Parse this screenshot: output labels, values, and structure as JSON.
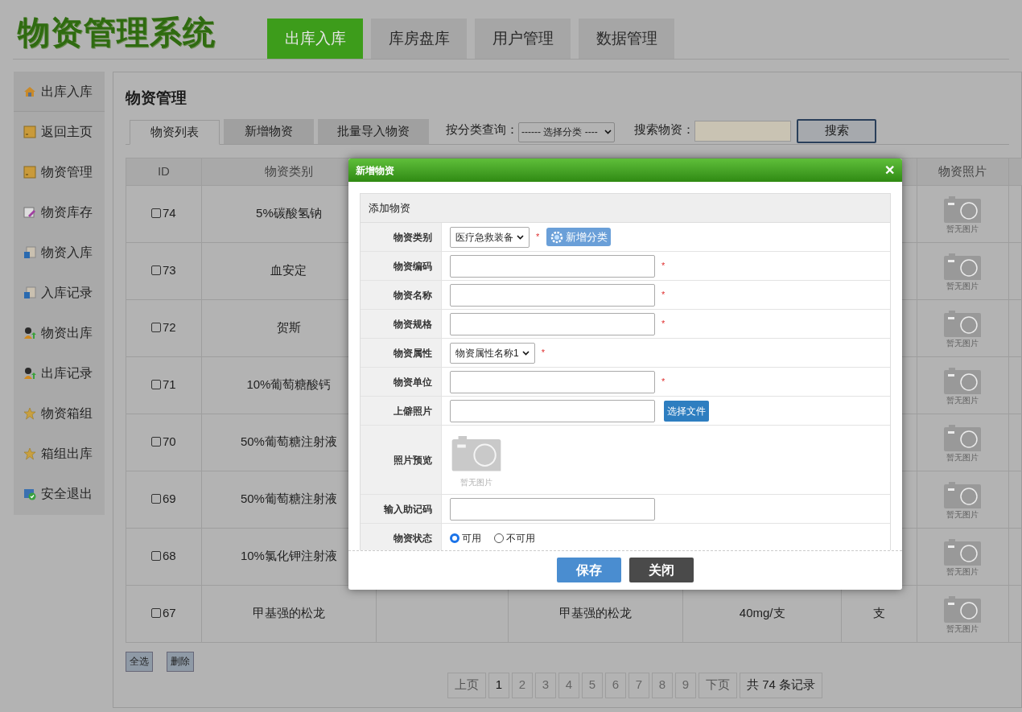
{
  "logo": "物资管理系统",
  "nav": [
    {
      "label": "出库入库",
      "selected": true
    },
    {
      "label": "库房盘库",
      "selected": false
    },
    {
      "label": "用户管理",
      "selected": false
    },
    {
      "label": "数据管理",
      "selected": false
    }
  ],
  "sidebar": {
    "items": [
      {
        "label": "出库入库",
        "selected": true
      },
      {
        "label": "返回主页",
        "selected": false
      },
      {
        "label": "物资管理",
        "selected": false
      },
      {
        "label": "物资库存",
        "selected": false
      },
      {
        "label": "物资入库",
        "selected": false
      },
      {
        "label": "入库记录",
        "selected": false
      },
      {
        "label": "物资出库",
        "selected": false
      },
      {
        "label": "出库记录",
        "selected": false
      },
      {
        "label": "物资箱组",
        "selected": false
      },
      {
        "label": "箱组出库",
        "selected": false
      },
      {
        "label": "安全退出",
        "selected": false
      }
    ]
  },
  "page_title": "物资管理",
  "tabs": [
    {
      "label": "物资列表",
      "selected": true
    },
    {
      "label": "新增物资",
      "selected": false
    },
    {
      "label": "批量导入物资",
      "selected": false
    }
  ],
  "filter": {
    "label": "按分类查询：",
    "value": "------ 选择分类 ----"
  },
  "search": {
    "label": "搜索物资：",
    "button": "搜索"
  },
  "table": {
    "columns": [
      "ID",
      "物资类别",
      "物资照片"
    ],
    "rows": [
      {
        "id": "74",
        "checked": false,
        "category": "5%碳酸氢钠",
        "photo_caption": "暂无图片"
      },
      {
        "id": "73",
        "checked": false,
        "category": "血安定",
        "photo_caption": "暂无图片"
      },
      {
        "id": "72",
        "checked": false,
        "category": "贺斯",
        "photo_caption": "暂无图片"
      },
      {
        "id": "71",
        "checked": false,
        "category": "10%葡萄糖酸钙",
        "photo_caption": "暂无图片"
      },
      {
        "id": "70",
        "checked": false,
        "category": "50%葡萄糖注射液",
        "photo_caption": "暂无图片"
      },
      {
        "id": "69",
        "checked": false,
        "category": "50%葡萄糖注射液",
        "photo_caption": "暂无图片"
      },
      {
        "id": "68",
        "checked": false,
        "category": "10%氯化钾注射液",
        "photo_caption": "暂无图片"
      },
      {
        "id": "67",
        "checked": false,
        "category": "甲基强的松龙",
        "column_4": "甲基强的松龙",
        "column_5": "40mg/支",
        "column_6": "支",
        "photo_caption": "暂无图片"
      }
    ]
  },
  "bulk_buttons": [
    "全选",
    "删除"
  ],
  "pagination": {
    "prev": "上页",
    "pages": [
      {
        "label": "1",
        "selected": true
      },
      {
        "label": "2",
        "selected": false
      },
      {
        "label": "3",
        "selected": false
      },
      {
        "label": "4",
        "selected": false
      },
      {
        "label": "5",
        "selected": false
      },
      {
        "label": "6",
        "selected": false
      },
      {
        "label": "7",
        "selected": false
      },
      {
        "label": "8",
        "selected": false
      },
      {
        "label": "9",
        "selected": false
      }
    ],
    "next": "下页",
    "total": "共 74 条记录"
  },
  "dialog": {
    "title": "新增物资",
    "close": "✕",
    "section": "添加物资",
    "fields": [
      {
        "kind": "select",
        "label": "物资类别",
        "value": "医疗急救装备",
        "required_mark": "*",
        "button": "新增分类"
      },
      {
        "kind": "text",
        "label": "物资编码",
        "required_mark": "*"
      },
      {
        "kind": "text",
        "label": "物资名称",
        "required_mark": "*"
      },
      {
        "kind": "text",
        "label": "物资规格",
        "required_mark": "*"
      },
      {
        "kind": "select",
        "label": "物资属性",
        "value": "物资属性名称1",
        "required_mark": "*"
      },
      {
        "kind": "text",
        "label": "物资单位",
        "required_mark": "*"
      },
      {
        "kind": "file",
        "label": "上僻照片",
        "button": "选择文件"
      },
      {
        "kind": "preview",
        "label": "照片预览",
        "caption": "暂无图片"
      },
      {
        "kind": "text",
        "label": "输入助记码"
      },
      {
        "kind": "radio",
        "label": "物资状态",
        "options": [
          {
            "label": "可用",
            "selected": true
          },
          {
            "label": "不可用",
            "selected": false
          }
        ]
      }
    ],
    "buttons": [
      {
        "label": "保存",
        "kind": "primary"
      },
      {
        "label": "关闭",
        "kind": "dark"
      }
    ]
  }
}
